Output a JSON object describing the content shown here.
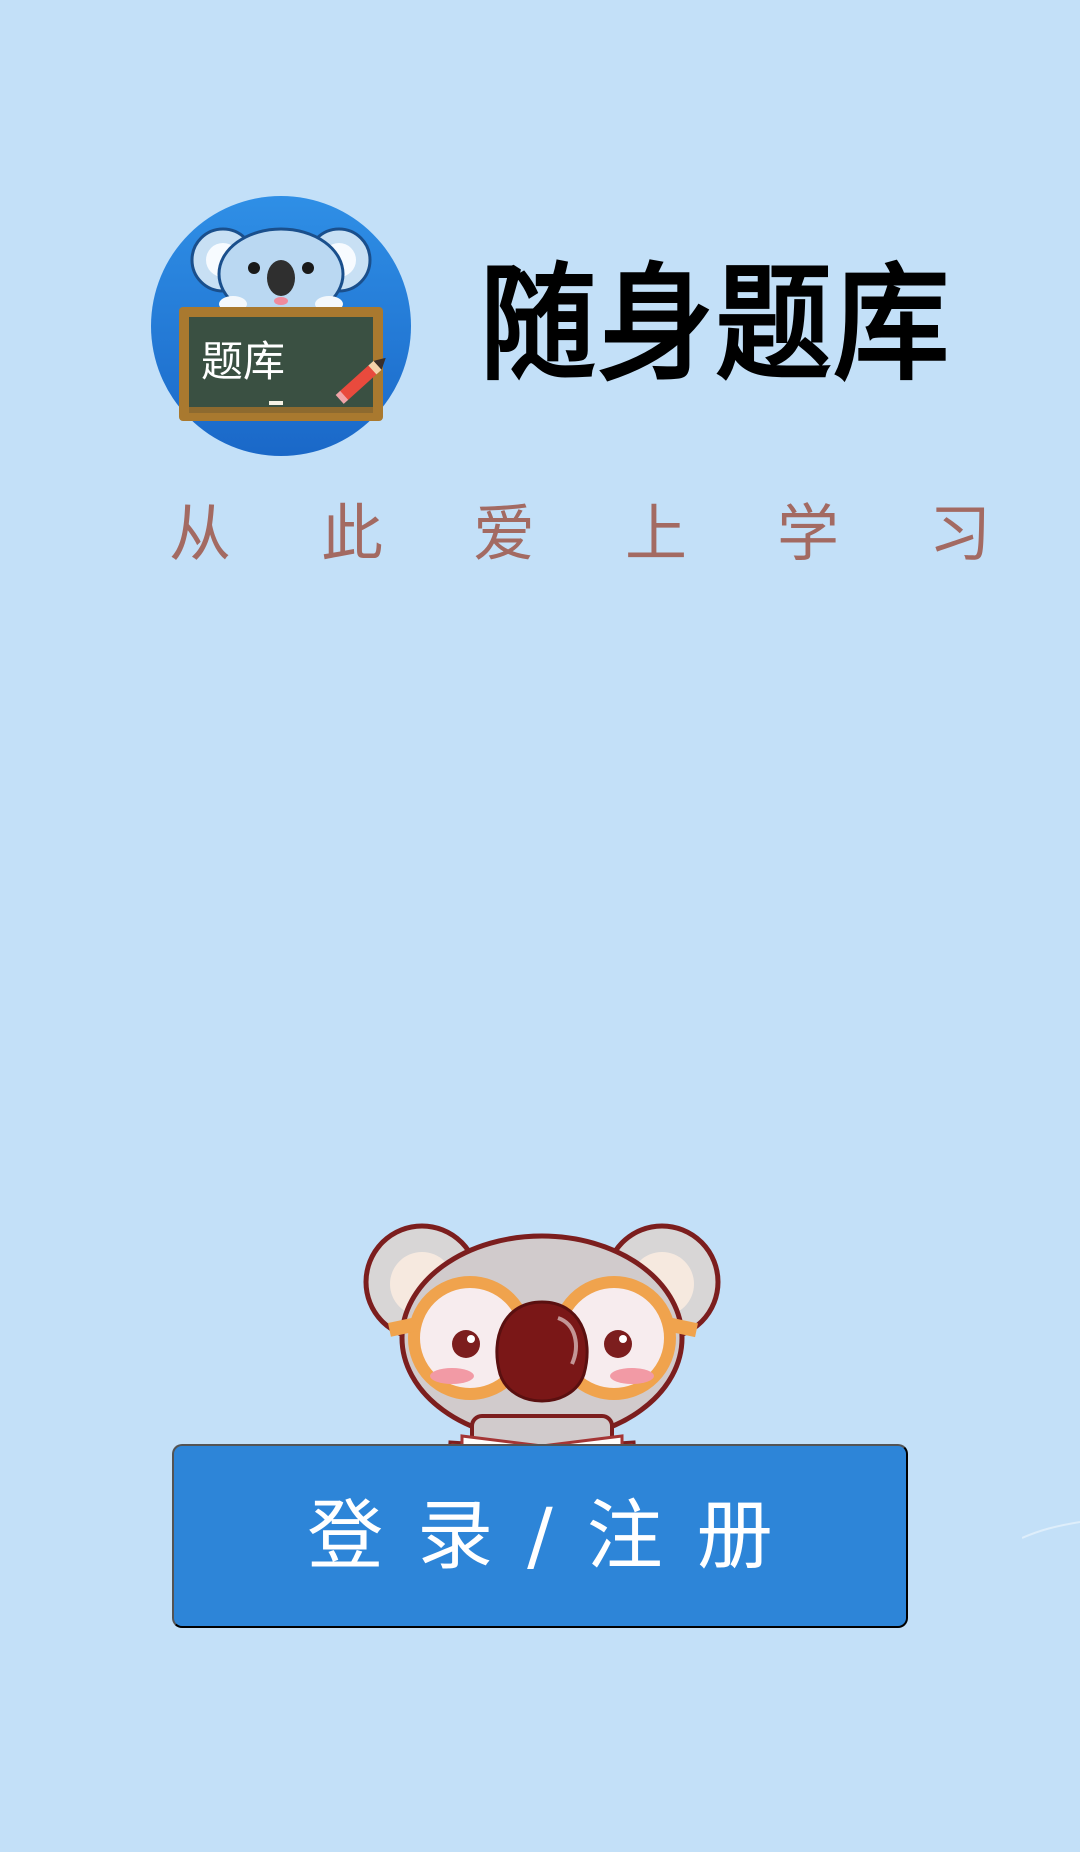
{
  "app": {
    "logo_text": "题库",
    "title": "随身题库",
    "slogan": [
      "从",
      "此",
      "爱",
      "上",
      "学",
      "习"
    ]
  },
  "login": {
    "label": "登录/注册"
  },
  "colors": {
    "background": "#c3e0f8",
    "accent": "#2d85d8",
    "title": "#000000",
    "slogan": "#a36a62"
  },
  "icons": {
    "logo": "koala-chalkboard-logo",
    "mascot": "koala-reading-mascot"
  }
}
